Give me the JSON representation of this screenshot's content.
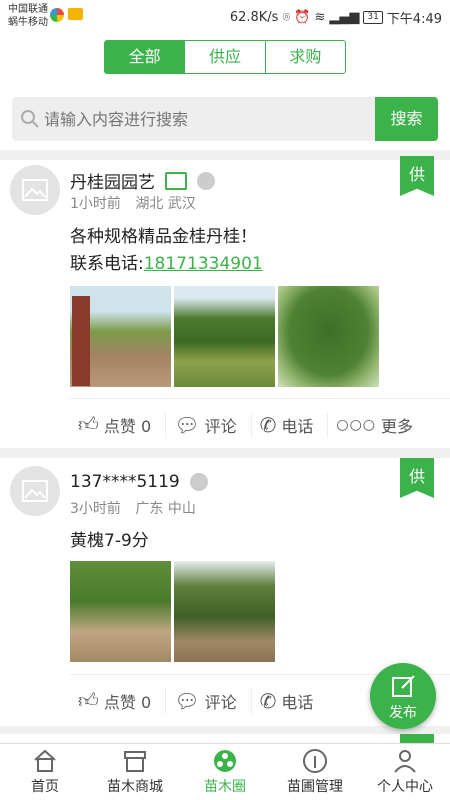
{
  "status_bar": {
    "carrier1": "中国联通",
    "carrier2": "蜗牛移动",
    "speed": "62.8K/s",
    "battery": "31",
    "time": "下午4:49"
  },
  "tabs": [
    {
      "label": "全部",
      "active": true
    },
    {
      "label": "供应",
      "active": false
    },
    {
      "label": "求购",
      "active": false
    }
  ],
  "search": {
    "placeholder": "请输入内容进行搜索",
    "button": "搜索"
  },
  "posts": [
    {
      "author": "丹桂园园艺",
      "time": "1小时前",
      "location": "湖北 武汉",
      "tag": "供",
      "text": "各种规格精品金桂丹桂！",
      "phone_prefix": "联系电话:",
      "phone": "18171334901",
      "photo_count": 3
    },
    {
      "author": "137****5119",
      "time": "3小时前",
      "location": "广东 中山",
      "tag": "供",
      "text": "黄槐7-9分",
      "photo_count": 2
    }
  ],
  "actions": {
    "like": "点赞 0",
    "comment": "评论",
    "call": "电话",
    "more": "更多"
  },
  "fab": {
    "label": "发布"
  },
  "bottom_nav": [
    {
      "label": "首页",
      "icon": "home-icon"
    },
    {
      "label": "苗木商城",
      "icon": "shop-icon"
    },
    {
      "label": "苗木圈",
      "icon": "circle-icon",
      "active": true
    },
    {
      "label": "苗圃管理",
      "icon": "tree-icon"
    },
    {
      "label": "个人中心",
      "icon": "person-icon"
    }
  ],
  "colors": {
    "accent": "#3bb34a"
  }
}
